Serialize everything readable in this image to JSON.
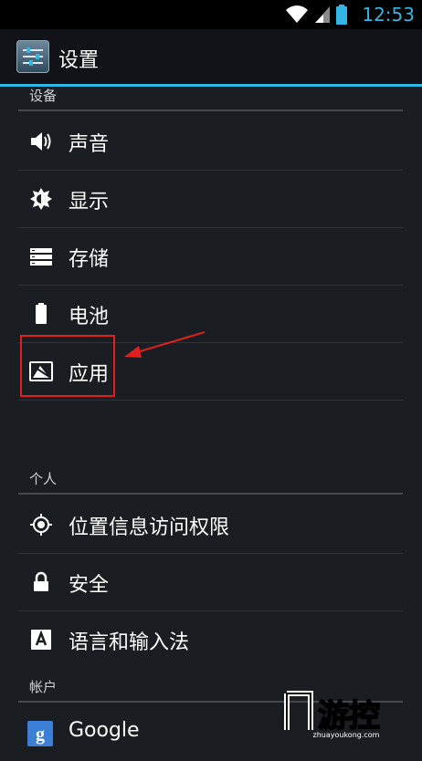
{
  "status_bar": {
    "time": "12:53"
  },
  "header": {
    "title": "设置"
  },
  "sections": [
    {
      "header": "设备",
      "items": [
        {
          "label": "声音",
          "icon": "speaker-icon"
        },
        {
          "label": "显示",
          "icon": "brightness-icon"
        },
        {
          "label": "存储",
          "icon": "storage-icon"
        },
        {
          "label": "电池",
          "icon": "battery-icon"
        },
        {
          "label": "应用",
          "icon": "apps-icon"
        }
      ]
    },
    {
      "header": "个人",
      "items": [
        {
          "label": "位置信息访问权限",
          "icon": "location-icon"
        },
        {
          "label": "安全",
          "icon": "lock-icon"
        },
        {
          "label": "语言和输入法",
          "icon": "keyboard-a-icon"
        }
      ]
    },
    {
      "header": "帐户",
      "items": [
        {
          "label": "Google",
          "icon": "google-icon"
        }
      ]
    }
  ],
  "watermark": {
    "text": "游控",
    "subtext": "zhuayoukong.com"
  },
  "colors": {
    "accent": "#33b5e5",
    "annotation": "#e0201c",
    "background": "#1a1d22"
  }
}
